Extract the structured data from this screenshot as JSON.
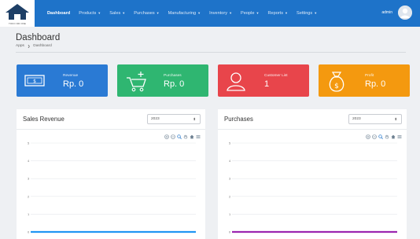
{
  "logo": {
    "caption": "TOKO DR ONE"
  },
  "nav": {
    "items": [
      {
        "label": "Dashboard",
        "caret": ""
      },
      {
        "label": "Products",
        "caret": "▼"
      },
      {
        "label": "Sales",
        "caret": "▼"
      },
      {
        "label": "Purchases",
        "caret": "▼"
      },
      {
        "label": "Manufacturing",
        "caret": "▼"
      },
      {
        "label": "Inventory",
        "caret": "▼"
      },
      {
        "label": "People",
        "caret": "▼"
      },
      {
        "label": "Reports",
        "caret": "▼"
      },
      {
        "label": "Settings",
        "caret": "▼"
      }
    ]
  },
  "user": {
    "name": "admin"
  },
  "page": {
    "title": "Dashboard",
    "breadcrumb": [
      "Apps",
      "Dashboard"
    ],
    "breadcrumb_sep": "❯"
  },
  "cards": [
    {
      "label": "Revenue",
      "value": "Rp. 0",
      "icon": "banknote-icon",
      "color": "#2a7ad4"
    },
    {
      "label": "Purchases",
      "value": "Rp. 0",
      "icon": "cart-add-icon",
      "color": "#2fb671"
    },
    {
      "label": "Customer List",
      "value": "1",
      "icon": "customer-icon",
      "color": "#e8454b"
    },
    {
      "label": "Profit",
      "value": "Rp. 0",
      "icon": "money-bag-icon",
      "color": "#f4990f"
    }
  ],
  "panels": {
    "sales": {
      "title": "Sales Revenue",
      "year": "2023",
      "arrow": "⬍"
    },
    "purchases": {
      "title": "Purchases",
      "year": "2023",
      "arrow": "⬍"
    }
  },
  "chart_data": [
    {
      "type": "line",
      "title": "Sales Revenue",
      "ylim": [
        0,
        5
      ],
      "yticks": [
        "5",
        "4",
        "3",
        "2",
        "1",
        "0"
      ],
      "series": [
        {
          "values": [
            0,
            0,
            0,
            0,
            0,
            0,
            0,
            0,
            0,
            0,
            0,
            0
          ],
          "color": "#2196f3"
        }
      ]
    },
    {
      "type": "line",
      "title": "Purchases",
      "ylim": [
        0,
        5
      ],
      "yticks": [
        "5",
        "4",
        "3",
        "2",
        "1",
        "0"
      ],
      "series": [
        {
          "values": [
            0,
            0,
            0,
            0,
            0,
            0,
            0,
            0,
            0,
            0,
            0,
            0
          ],
          "color": "#9c27b0"
        }
      ]
    }
  ]
}
